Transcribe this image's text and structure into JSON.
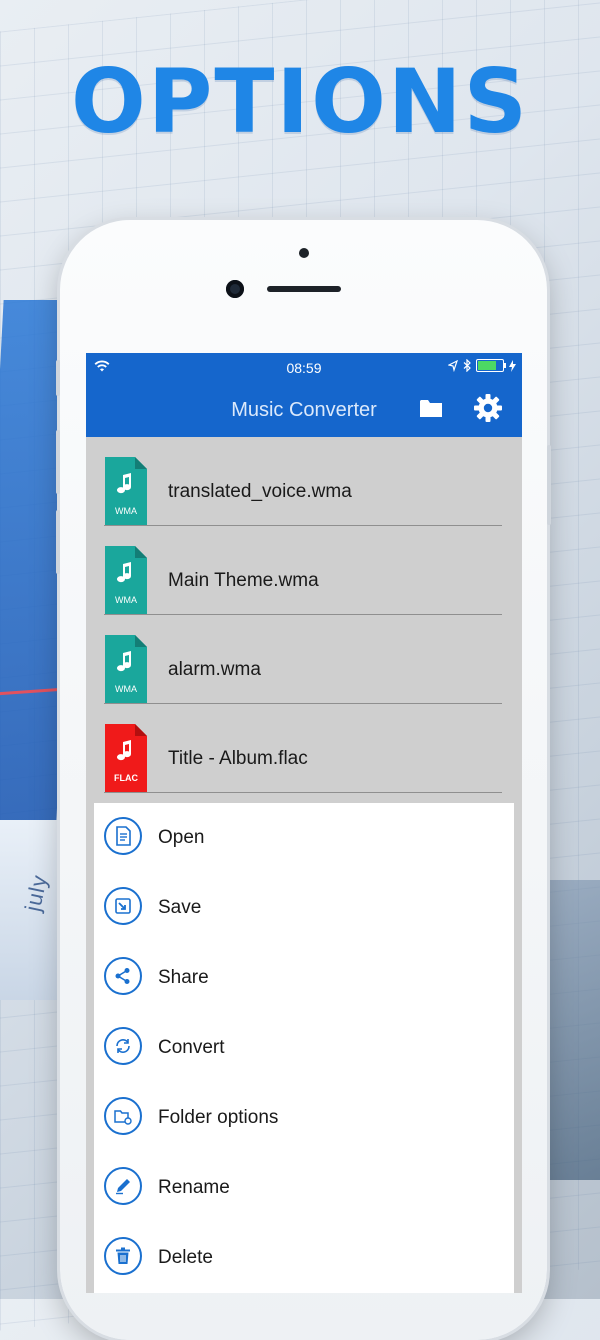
{
  "hero": {
    "title": "OPTIONS"
  },
  "background": {
    "chart_label": "july"
  },
  "status_bar": {
    "time": "08:59"
  },
  "nav": {
    "title": "Music Converter"
  },
  "files": [
    {
      "name": "translated_voice.wma",
      "type": "WMA",
      "color": "#1aa79c"
    },
    {
      "name": "Main Theme.wma",
      "type": "WMA",
      "color": "#1aa79c"
    },
    {
      "name": "alarm.wma",
      "type": "WMA",
      "color": "#1aa79c"
    },
    {
      "name": "Title  - Album.flac",
      "type": "FLAC",
      "color": "#f01a1a"
    }
  ],
  "actions": [
    {
      "label": "Open",
      "icon": "open-document-icon"
    },
    {
      "label": "Save",
      "icon": "save-icon"
    },
    {
      "label": "Share",
      "icon": "share-icon"
    },
    {
      "label": "Convert",
      "icon": "convert-icon"
    },
    {
      "label": "Folder options",
      "icon": "folder-options-icon"
    },
    {
      "label": "Rename",
      "icon": "rename-pencil-icon"
    },
    {
      "label": "Delete",
      "icon": "trash-icon"
    }
  ],
  "colors": {
    "accent": "#1566cc",
    "hero": "#1f86e6",
    "wma": "#1aa79c",
    "flac": "#f01a1a"
  }
}
